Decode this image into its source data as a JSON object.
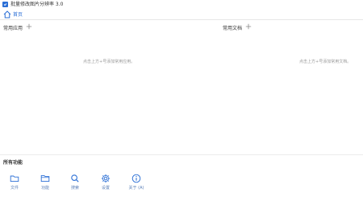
{
  "app": {
    "title": "批量修改图片分辨率 3.0",
    "accent_color": "#2b6fd6"
  },
  "tabs": {
    "home_label": "首页",
    "home_icon": "home-icon"
  },
  "frequent_apps": {
    "title": "常用应用",
    "add_icon": "plus-icon",
    "empty_text": "点击上方+号添加常用应用。"
  },
  "frequent_docs": {
    "title": "常用文档",
    "add_icon": "plus-icon",
    "empty_text": "点击上方+号添加常用文档。"
  },
  "all_functions": {
    "title": "所有功能",
    "items": [
      {
        "label": "文件",
        "icon": "file-icon"
      },
      {
        "label": "功能",
        "icon": "folder-icon"
      },
      {
        "label": "搜索",
        "icon": "search-icon"
      },
      {
        "label": "设置",
        "icon": "gear-icon"
      },
      {
        "label": "关于 (A)",
        "icon": "info-icon"
      }
    ]
  }
}
